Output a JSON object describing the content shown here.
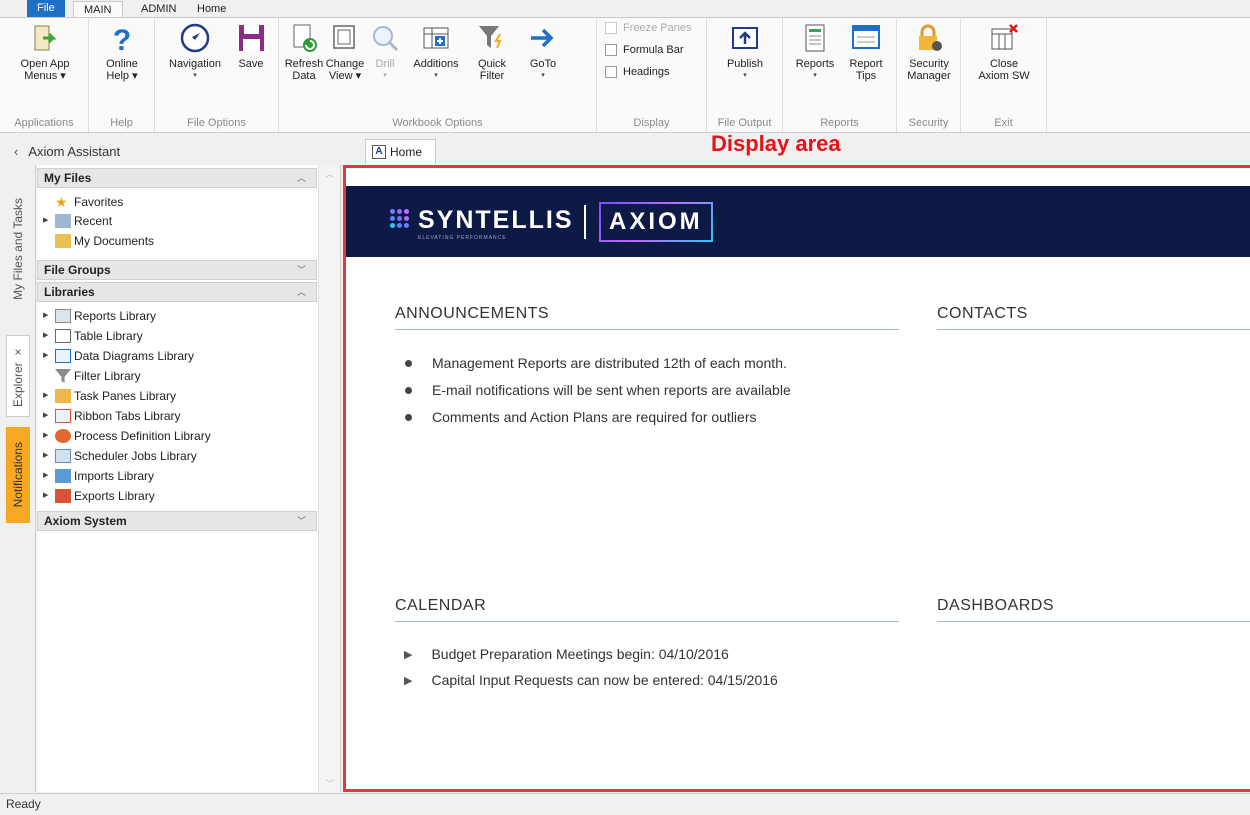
{
  "ribbon_tabs": [
    "File",
    "MAIN",
    "ADMIN",
    "Home"
  ],
  "groups": {
    "applications": {
      "label": "Applications",
      "open_app": "Open App",
      "open_app2": "Menus"
    },
    "help": {
      "label": "Help",
      "online": "Online",
      "online2": "Help"
    },
    "file_options": {
      "label": "File Options",
      "navigation": "Navigation",
      "save": "Save"
    },
    "workbook": {
      "label": "Workbook Options",
      "refresh": "Refresh",
      "refresh2": "Data",
      "change": "Change",
      "change2": "View",
      "drill": "Drill",
      "additions": "Additions",
      "quick": "Quick",
      "quick2": "Filter",
      "goto": "GoTo"
    },
    "display": {
      "label": "Display",
      "freeze": "Freeze Panes",
      "formula": "Formula Bar",
      "headings": "Headings"
    },
    "file_output": {
      "label": "File Output",
      "publish": "Publish"
    },
    "reports": {
      "label": "Reports",
      "reports": "Reports",
      "tips": "Report",
      "tips2": "Tips"
    },
    "security": {
      "label": "Security",
      "manager": "Security",
      "manager2": "Manager"
    },
    "exit": {
      "label": "Exit",
      "close": "Close",
      "close2": "Axiom SW"
    }
  },
  "assistant": {
    "title": "Axiom Assistant"
  },
  "vtabs": {
    "myfiles": "My Files and Tasks",
    "explorer": "Explorer",
    "explorer_close": "×",
    "notifications": "Notifications"
  },
  "explorer": {
    "my_files": "My Files",
    "my_files_items": [
      "Favorites",
      "Recent",
      "My Documents"
    ],
    "file_groups": "File Groups",
    "libraries": "Libraries",
    "library_items": [
      "Reports Library",
      "Table Library",
      "Data Diagrams Library",
      "Filter Library",
      "Task Panes Library",
      "Ribbon Tabs Library",
      "Process Definition Library",
      "Scheduler Jobs Library",
      "Imports Library",
      "Exports Library"
    ],
    "axiom_system": "Axiom System"
  },
  "doc_tab": {
    "icon": "A",
    "label": "Home"
  },
  "display_label": "Display area",
  "banner": {
    "brand": "SYNTELLIS",
    "tagline": "ELEVATING PERFORMANCE",
    "product": "AXIOM"
  },
  "sections": {
    "announcements": "ANNOUNCEMENTS",
    "contacts": "CONTACTS",
    "calendar": "CALENDAR",
    "dashboards": "DASHBOARDS"
  },
  "announcements": [
    "Management Reports are distributed 12th of each month.",
    "E-mail notifications will be sent when reports are available",
    "Comments and Action Plans are required for outliers"
  ],
  "calendar": [
    "Budget Preparation Meetings begin: 04/10/2016",
    "Capital Input Requests can now be entered: 04/15/2016"
  ],
  "status": "Ready",
  "colors": {
    "accent": "#1e6fc6",
    "display_border": "#e5383b",
    "banner": "#0d1a45",
    "notifications": "#f7a823"
  }
}
